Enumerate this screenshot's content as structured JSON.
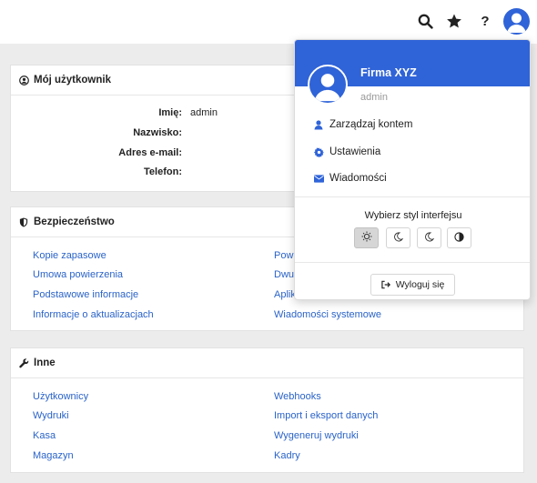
{
  "topbar": {
    "icons": [
      "search-icon",
      "star-icon",
      "help-icon",
      "user-avatar-icon"
    ],
    "help_label": "?"
  },
  "user_card": {
    "title": "Mój użytkownik",
    "fields": [
      {
        "label": "Imię:",
        "value": "admin"
      },
      {
        "label": "Nazwisko:",
        "value": ""
      },
      {
        "label": "Adres e-mail:",
        "value": ""
      },
      {
        "label": "Telefon:",
        "value": ""
      }
    ]
  },
  "security_card": {
    "title": "Bezpieczeństwo",
    "left_links": [
      "Kopie zapasowe",
      "Umowa powierzenia",
      "Podstawowe informacje",
      "Informacje o aktualizacjach"
    ],
    "right_links": [
      "Powi",
      "Dwu",
      "Aplik",
      "Wiadomości systemowe"
    ]
  },
  "other_card": {
    "title": "Inne",
    "left_links": [
      "Użytkownicy",
      "Wydruki",
      "Kasa",
      "Magazyn"
    ],
    "right_links": [
      "Webhooks",
      "Import i eksport danych",
      "Wygeneruj wydruki",
      "Kadry"
    ]
  },
  "dropdown": {
    "company": "Firma XYZ",
    "username": "admin",
    "items": [
      {
        "label": "Zarządzaj kontem",
        "icon": "user-icon"
      },
      {
        "label": "Ustawienia",
        "icon": "gear-icon"
      },
      {
        "label": "Wiadomości",
        "icon": "envelope-icon"
      }
    ],
    "theme_title": "Wybierz styl interfejsu",
    "themes": [
      "sun-icon",
      "moon-icon",
      "moon-icon",
      "contrast-icon"
    ],
    "active_theme": 0,
    "logout_label": "Wyloguj się"
  },
  "colors": {
    "accent": "#2f63d8",
    "link": "#2a63c8",
    "background": "#ececec"
  }
}
